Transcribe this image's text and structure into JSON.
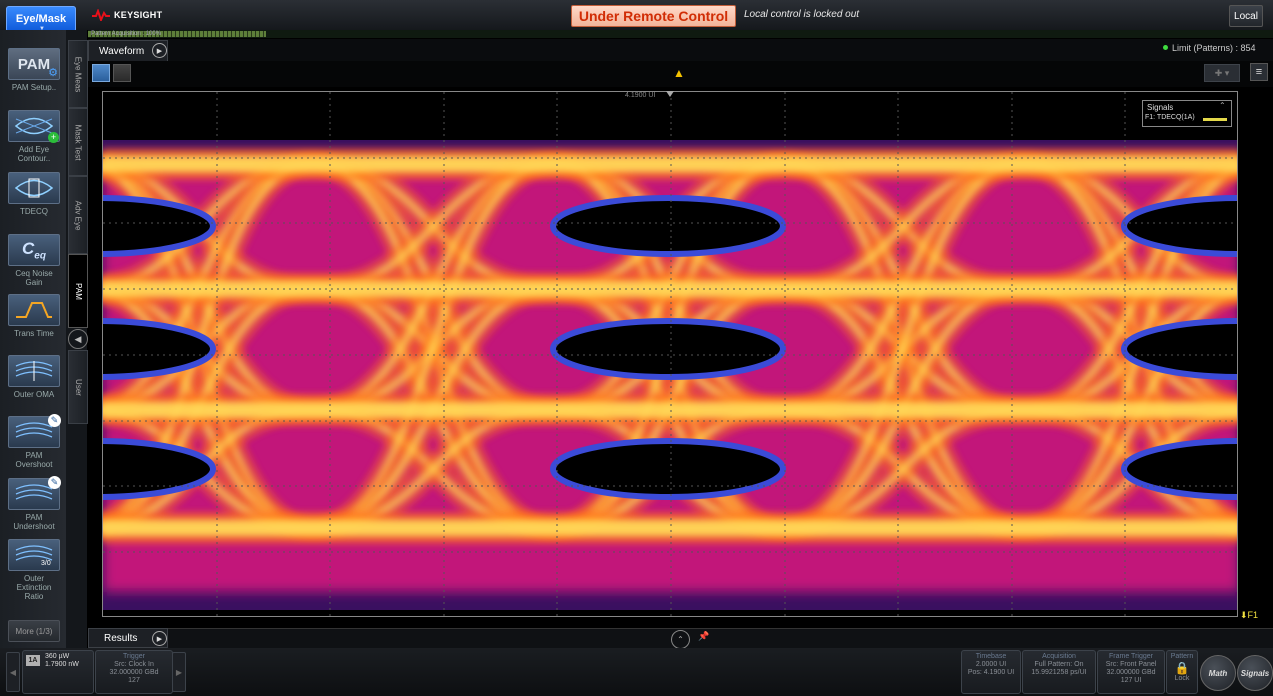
{
  "topbar": {
    "app_button": "Eye/Mask",
    "brand": "KEYSIGHT",
    "remote_banner": "Under Remote Control",
    "remote_note": "Local control is locked out",
    "local_button": "Local"
  },
  "acquisition": {
    "label": "Pattern Acquisition : 100%",
    "progress": 0.15
  },
  "tools": [
    {
      "label": "PAM Setup..",
      "icon": "pam-setup-icon"
    },
    {
      "label": "Add Eye Contour..",
      "icon": "eye-contour-icon"
    },
    {
      "label": "TDECQ",
      "icon": "tdecq-icon"
    },
    {
      "label": "Ceq Noise Gain",
      "icon": "ceq-icon"
    },
    {
      "label": "Trans Time",
      "icon": "transition-time-icon"
    },
    {
      "label": "Outer OMA",
      "icon": "outer-oma-icon"
    },
    {
      "label": "PAM Overshoot",
      "icon": "pam-overshoot-icon"
    },
    {
      "label": "PAM Undershoot",
      "icon": "pam-undershoot-icon"
    },
    {
      "label": "Outer Extinction Ratio",
      "icon": "outer-er-icon"
    }
  ],
  "more_button": "More (1/3)",
  "vtabs": [
    "Eye Meas",
    "Mask Test",
    "Adv Eye",
    "PAM",
    "User"
  ],
  "waveform": {
    "tab": "Waveform",
    "limit": "Limit (Patterns) : 854",
    "trigger_ref": "4.1900 UI",
    "legend_title": "Signals",
    "legend_item": "F1: TDECQ(1A)",
    "marker": "F1",
    "trace_color": "#e4d94a"
  },
  "results": {
    "tab": "Results"
  },
  "status": {
    "channel": {
      "badge": "1A",
      "line1": "360 µW",
      "line2": "1.7900 nW"
    },
    "trigger": {
      "title": "Trigger",
      "line1": "Src: Clock In",
      "line2": "32.000000 GBd",
      "line3": "127"
    },
    "timebase": {
      "title": "Timebase",
      "line1": "2.0000 UI",
      "line2": "Pos: 4.1900 UI"
    },
    "acquisition": {
      "title": "Acquisition",
      "line1": "Full Pattern: On",
      "line2": "15.9921258 ps/UI"
    },
    "frame_trigger": {
      "title": "Frame Trigger",
      "line1": "Src: Front Panel",
      "line2": "32.000000 GBd",
      "line3": "127 UI"
    },
    "pattern": {
      "title": "Pattern",
      "lock": "Lock"
    },
    "math_button": "Math",
    "signals_button": "Signals"
  }
}
